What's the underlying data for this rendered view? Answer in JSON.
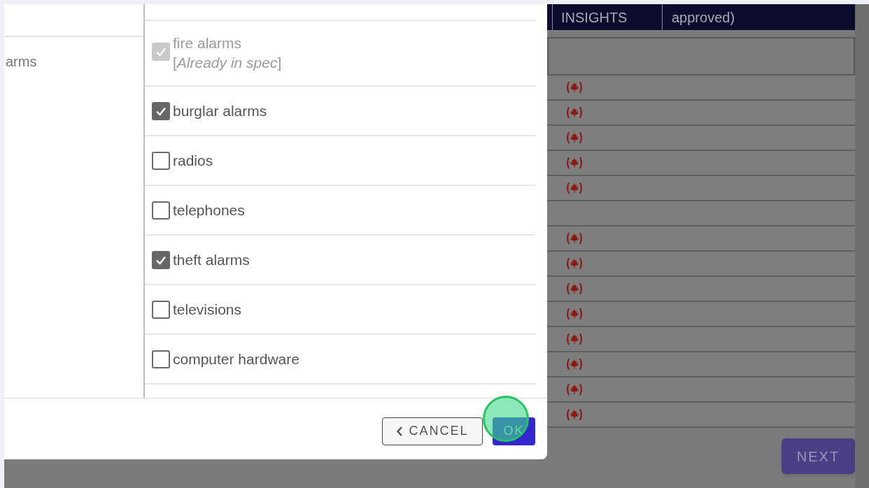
{
  "left_panel": {
    "text": "arms"
  },
  "options": [
    {
      "label": "fire alarms",
      "note": "[*Already in spec*]",
      "checked": true,
      "disabled": true
    },
    {
      "label": "burglar alarms",
      "checked": true,
      "disabled": false
    },
    {
      "label": "radios",
      "checked": false,
      "disabled": false
    },
    {
      "label": "telephones",
      "checked": false,
      "disabled": false
    },
    {
      "label": "theft alarms",
      "checked": true,
      "disabled": false
    },
    {
      "label": "televisions",
      "checked": false,
      "disabled": false
    },
    {
      "label": "computer hardware",
      "checked": false,
      "disabled": false
    }
  ],
  "dialog_buttons": {
    "cancel": "CANCEL",
    "ok": "OK"
  },
  "background": {
    "header": [
      "INSIGHTS",
      "approved)"
    ],
    "rows": [
      {
        "canadian": true
      },
      {
        "canadian": true
      },
      {
        "canadian": true
      },
      {
        "canadian": true
      },
      {
        "canadian": true
      },
      {
        "canadian": false
      },
      {
        "canadian": true
      },
      {
        "canadian": true
      },
      {
        "canadian": true
      },
      {
        "canadian": true
      },
      {
        "canadian": true
      },
      {
        "canadian": true
      },
      {
        "canadian": true
      },
      {
        "canadian": true
      }
    ],
    "next": "NEXT"
  }
}
